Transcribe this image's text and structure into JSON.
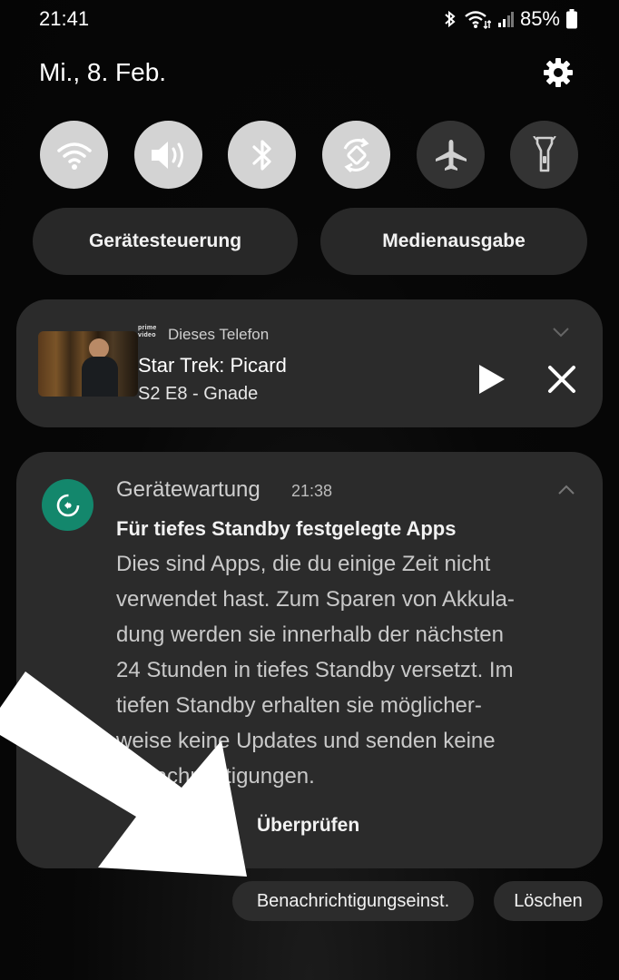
{
  "status_bar": {
    "time": "21:41",
    "battery": "85%",
    "icons": [
      "bluetooth-icon",
      "wifi-icon",
      "signal-icon",
      "battery-icon"
    ]
  },
  "header": {
    "date": "Mi., 8. Feb.",
    "settings_icon": "gear-icon"
  },
  "quick_toggles": [
    {
      "name": "wifi",
      "icon": "wifi-icon",
      "state": "on"
    },
    {
      "name": "sound",
      "icon": "speaker-icon",
      "state": "on"
    },
    {
      "name": "bluetooth",
      "icon": "bluetooth-icon",
      "state": "on"
    },
    {
      "name": "auto-rotate",
      "icon": "rotate-icon",
      "state": "on"
    },
    {
      "name": "airplane-mode",
      "icon": "airplane-icon",
      "state": "off"
    },
    {
      "name": "flashlight",
      "icon": "flashlight-icon",
      "state": "off"
    }
  ],
  "pills": {
    "device_control": "Gerätesteuerung",
    "media_output": "Medienausgabe"
  },
  "media": {
    "logo_text": "prime video",
    "source": "Dieses Telefon",
    "title": "Star Trek: Picard",
    "subtitle": "S2 E8 - Gnade"
  },
  "notification": {
    "app_name": "Gerätewartung",
    "time": "21:38",
    "title": "Für tiefes Standby festgelegte Apps",
    "body_lines": [
      "Dies sind Apps, die du einige Zeit nicht",
      "verwendet hast. Zum Sparen von Akkula-",
      "dung werden sie innerhalb der nächsten",
      "24 Stunden in tiefes Standby versetzt. Im",
      "tiefen Standby erhalten sie möglicher-",
      "weise keine Updates und senden keine",
      "Benachrichtigungen."
    ],
    "action": "Überprüfen"
  },
  "bottom_actions": {
    "notification_settings": "Benachrichtigungseinst.",
    "clear": "Löschen"
  },
  "colors": {
    "card_bg": "#2b2b2b",
    "toggle_on": "#d3d3d3",
    "toggle_off": "#333333",
    "app_icon": "#13876c"
  }
}
